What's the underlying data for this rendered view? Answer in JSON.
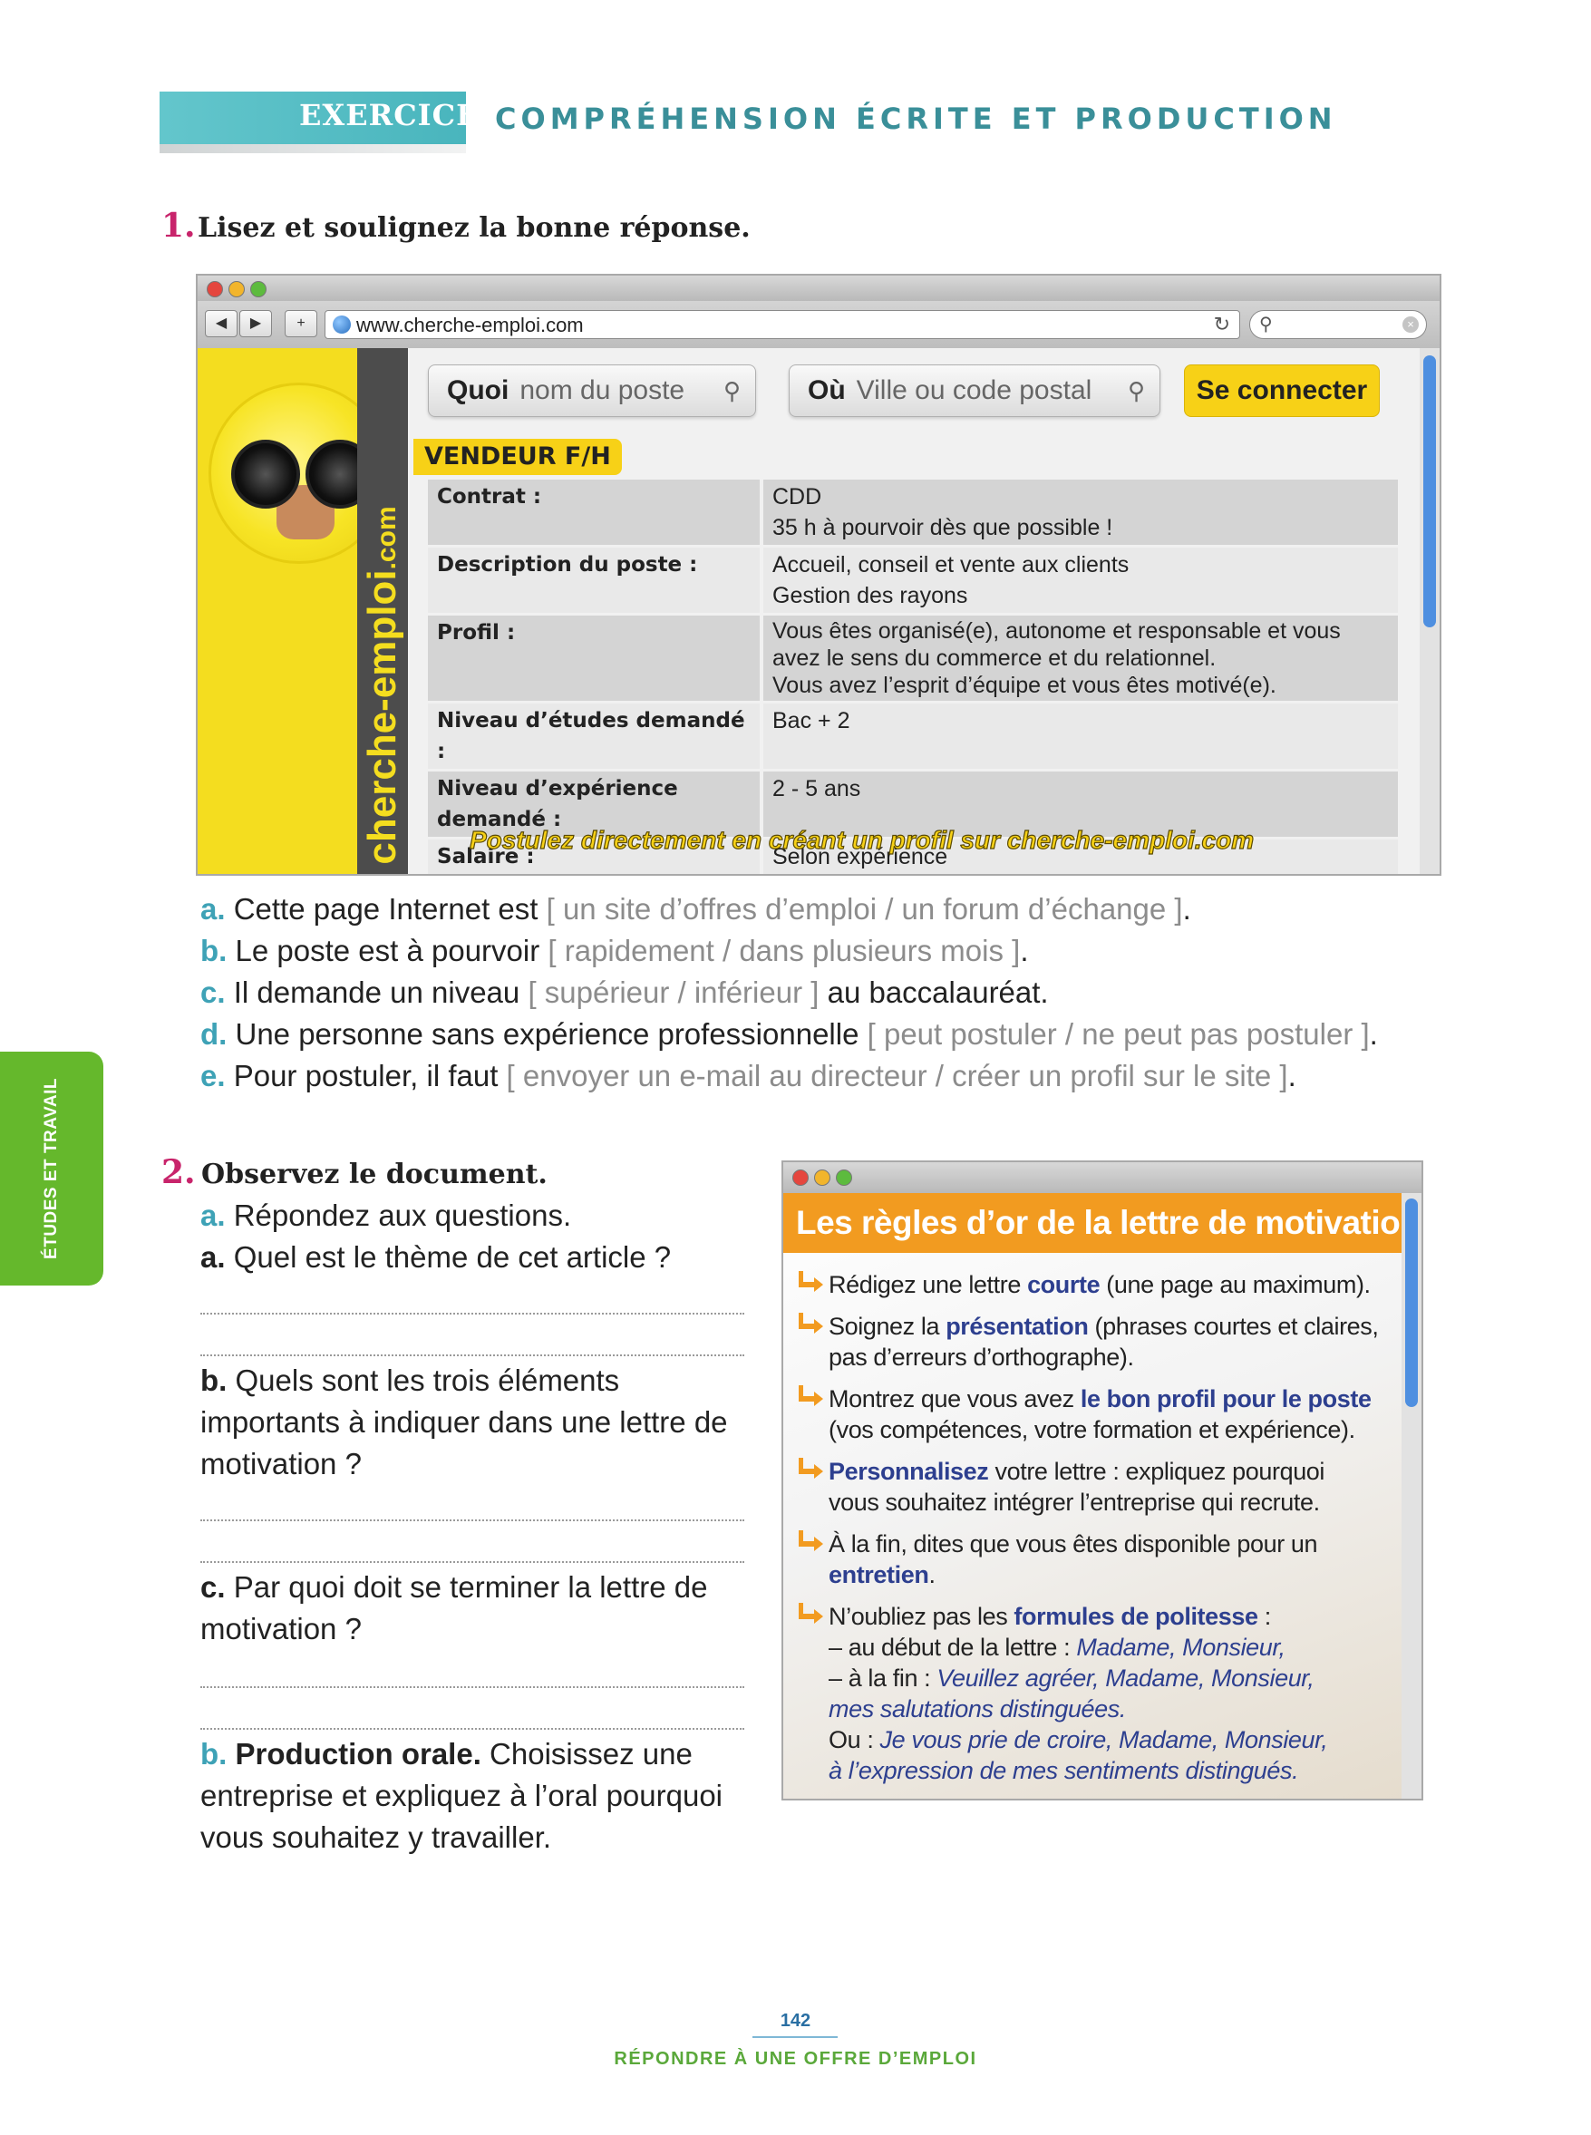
{
  "header": {
    "exercices_label": "EXERCICES",
    "section_title": "COMPRÉHENSION ÉCRITE ET PRODUCTION"
  },
  "exercise1": {
    "number": "1.",
    "instruction": "Lisez et soulignez la bonne réponse.",
    "browser": {
      "url": "www.cherche-emploi.com",
      "site_name": "cherche-emploi",
      "site_tld": ".com",
      "search_what_label": "Quoi",
      "search_what_placeholder": "nom du poste",
      "search_where_label": "Où",
      "search_where_placeholder": "Ville ou code postal",
      "connect_label": "Se connecter",
      "job_title": "VENDEUR F/H",
      "rows": [
        {
          "label": "Contrat :",
          "lines": [
            "CDD",
            "35 h à pourvoir dès que possible !"
          ]
        },
        {
          "label": "Description du poste :",
          "lines": [
            "Accueil, conseil et vente aux clients",
            "Gestion des rayons"
          ]
        },
        {
          "label": "Profil :",
          "lines": [
            "Vous êtes organisé(e), autonome et responsable et vous",
            "avez le sens du commerce et du relationnel.",
            "Vous avez l’esprit d’équipe et vous êtes motivé(e)."
          ]
        },
        {
          "label": "Niveau d’études demandé :",
          "lines": [
            "Bac + 2"
          ]
        },
        {
          "label": "Niveau d’expérience demandé :",
          "lines": [
            "2 - 5 ans"
          ]
        },
        {
          "label": "Salaire :",
          "lines": [
            "Selon expérience"
          ]
        }
      ],
      "apply_text": "Postulez directement en créant un profil sur cherche-emploi.com"
    },
    "questions": [
      {
        "letter": "a.",
        "pre": "Cette page Internet est",
        "options": "[ un site d’offres d’emploi / un forum d’échange ]",
        "post": "."
      },
      {
        "letter": "b.",
        "pre": "Le poste est à pourvoir",
        "options": "[ rapidement / dans plusieurs mois ]",
        "post": "."
      },
      {
        "letter": "c.",
        "pre": "Il demande un niveau",
        "options": "[ supérieur / inférieur ]",
        "post": "au baccalauréat."
      },
      {
        "letter": "d.",
        "pre": "Une personne sans expérience professionnelle",
        "options": "[ peut postuler / ne peut pas postuler ]",
        "post": "."
      },
      {
        "letter": "e.",
        "pre": "Pour postuler, il faut",
        "options": "[ envoyer un e-mail au directeur / créer un profil sur le site ]",
        "post": "."
      }
    ]
  },
  "side_tab": "ÉTUDES ET TRAVAIL",
  "exercise2": {
    "number": "2.",
    "instruction": "Observez le document.",
    "part_a": {
      "letter": "a.",
      "text": "Répondez aux questions."
    },
    "qa": {
      "letter": "a.",
      "text": "Quel est le thème de cet article ?"
    },
    "qb": {
      "letter": "b.",
      "lines": [
        "Quels sont les trois éléments",
        "importants à indiquer dans une lettre de",
        "motivation ?"
      ]
    },
    "qc": {
      "letter": "c.",
      "lines": [
        "Par quoi doit se terminer la lettre de",
        "motivation ?"
      ]
    },
    "part_b": {
      "letter": "b.",
      "bold": "Production orale.",
      "lines": [
        "Choisissez une",
        "entreprise et expliquez à l’oral pourquoi",
        "vous souhaitez y travailler."
      ]
    },
    "article": {
      "title": "Les règles d’or de la lettre de motivation",
      "r1": {
        "a": "Rédigez une lettre",
        "b": "courte",
        "c": "(une page au maximum)."
      },
      "r2": {
        "a": "Soignez la",
        "b": "présentation",
        "c": "(phrases courtes et claires,",
        "d": "pas d’erreurs d’orthographe)."
      },
      "r3": {
        "a": "Montrez que vous avez",
        "b": "le bon profil pour le poste",
        "c": "(vos compétences, votre formation et expérience)."
      },
      "r4": {
        "b": "Personnalisez",
        "a": "votre lettre : expliquez pourquoi",
        "c": "vous souhaitez intégrer l’entreprise qui recrute."
      },
      "r5": {
        "a": "À la fin, dites que vous êtes disponible pour un",
        "b": "entretien",
        "c": "."
      },
      "r6": {
        "a": "N’oubliez pas les",
        "b": "formules de politesse",
        "c": ":",
        "l1a": "– au début de la lettre :",
        "l1b": "Madame, Monsieur,",
        "l2a": "– à la fin :",
        "l2b": "Veuillez agréer, Madame, Monsieur,",
        "l3b": "mes salutations distinguées.",
        "l4a": "Ou :",
        "l4b": "Je vous prie de croire, Madame, Monsieur,",
        "l5b": "à l’expression de mes sentiments distingués."
      }
    }
  },
  "footer": {
    "page_number": "142",
    "chapter": "RÉPONDRE À UNE OFFRE D’EMPLOI"
  },
  "colors": {
    "teal": "#3a8f99",
    "magenta": "#c8246b",
    "site_yellow": "#f4dd1f",
    "orange": "#f29b20",
    "navy": "#2d3f8f",
    "green": "#65b82c"
  }
}
